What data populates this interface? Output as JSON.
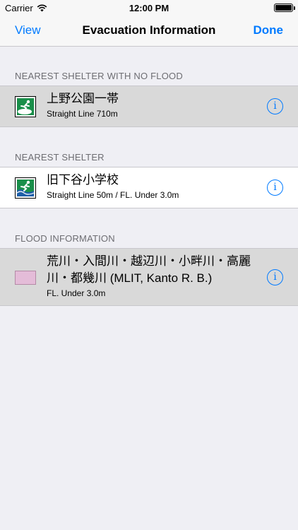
{
  "status_bar": {
    "carrier": "Carrier",
    "time": "12:00 PM"
  },
  "nav": {
    "left_label": "View",
    "title": "Evacuation Information",
    "right_label": "Done"
  },
  "sections": [
    {
      "header": "NEAREST SHELTER WITH NO FLOOD",
      "title": "上野公園一帯",
      "subtitle": "Straight Line 710m",
      "icon": "evacuation-site-icon"
    },
    {
      "header": "NEAREST SHELTER",
      "title": "旧下谷小学校",
      "subtitle": "Straight Line 50m / FL. Under 3.0m",
      "icon": "tsunami-shelter-icon"
    },
    {
      "header": "FLOOD INFORMATION",
      "title_line1": "荒川・入間川・越辺川・小畔川・高麗",
      "title_line2": "川・都幾川 (MLIT, Kanto R. B.)",
      "subtitle": "FL. Under 3.0m",
      "swatch_color": "#e4bcd8"
    }
  ],
  "colors": {
    "accent": "#007aff",
    "selected_row": "#d9d9d9",
    "background": "#efeff4"
  }
}
